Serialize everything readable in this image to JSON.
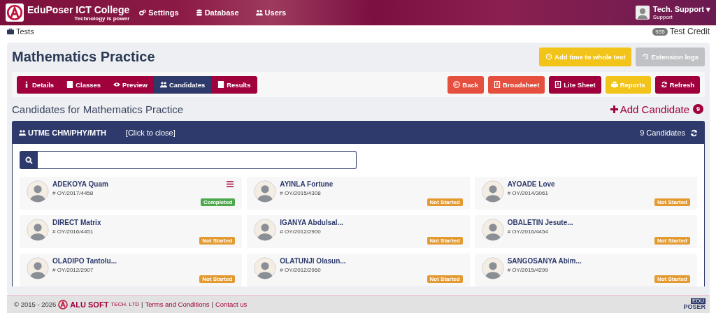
{
  "header": {
    "brand": "EduPoser ICT College",
    "tagline": "Technology is power",
    "nav": [
      "Settings",
      "Database",
      "Users"
    ],
    "user": {
      "name": "Tech. Support ▾",
      "role": "Support"
    }
  },
  "breadcrumb": "Tests",
  "credit": {
    "count": "935",
    "label": "Test Credit"
  },
  "title": "Mathematics Practice",
  "top_buttons": [
    {
      "label": "Add time to whole test",
      "kind": "warning"
    },
    {
      "label": "Extension logs",
      "kind": "muted"
    }
  ],
  "tabs": [
    {
      "label": "Details",
      "selected": false
    },
    {
      "label": "Classes",
      "selected": false
    },
    {
      "label": "Preview",
      "selected": false
    },
    {
      "label": "Candidates",
      "selected": true
    },
    {
      "label": "Results",
      "selected": false
    }
  ],
  "actions": [
    {
      "label": "Back",
      "kind": "danger"
    },
    {
      "label": "Broadsheet",
      "kind": "danger"
    },
    {
      "label": "Lite Sheet",
      "kind": "maroon"
    },
    {
      "label": "Reports",
      "kind": "warning"
    },
    {
      "label": "Refresh",
      "kind": "maroon"
    }
  ],
  "section_title": "Candidates for Mathematics Practice",
  "add_candidate": {
    "label": "Add Candidate",
    "count": "9"
  },
  "group": {
    "name": "UTME CHM/PHY/MTH",
    "toggle": "[Click to close]",
    "count": "9 Candidates"
  },
  "candidates": [
    {
      "name": "ADEKOYA Quam",
      "id": "# OY/2017/4458",
      "status": "Completed",
      "kind": "completed",
      "menu": true
    },
    {
      "name": "AYINLA Fortune",
      "id": "# OY/2015/4308",
      "status": "Not Started",
      "kind": "not_started",
      "menu": false
    },
    {
      "name": "AYOADE Love",
      "id": "# OY/2014/3061",
      "status": "Not Started",
      "kind": "not_started",
      "menu": false
    },
    {
      "name": "DIRECT Matrix",
      "id": "# OY/2016/4451",
      "status": "Not Started",
      "kind": "not_started",
      "menu": false
    },
    {
      "name": "IGANYA Abdulsal...",
      "id": "# OY/2012/2900",
      "status": "Not Started",
      "kind": "not_started",
      "menu": false
    },
    {
      "name": "OBALETIN Jesute...",
      "id": "# OY/2016/4454",
      "status": "Not Started",
      "kind": "not_started",
      "menu": false
    },
    {
      "name": "OLADIPO Tantolu...",
      "id": "# OY/2012/2907",
      "status": "Not Started",
      "kind": "not_started",
      "menu": false
    },
    {
      "name": "OLATUNJI Olasun...",
      "id": "# OY/2012/2960",
      "status": "Not Started",
      "kind": "not_started",
      "menu": false
    },
    {
      "name": "SANGOSANYA Abim...",
      "id": "# OY/2015/4299",
      "status": "Not Started",
      "kind": "not_started",
      "menu": false
    }
  ],
  "footer": {
    "copyright": "© 2015 - 2026",
    "company": "ALU SOFT",
    "company_suffix": "TECH. LTD",
    "sep": "|",
    "links": [
      "Terms and Conditions",
      "Contact us"
    ],
    "logo_top": "EDU",
    "logo_bottom": "POSER"
  }
}
